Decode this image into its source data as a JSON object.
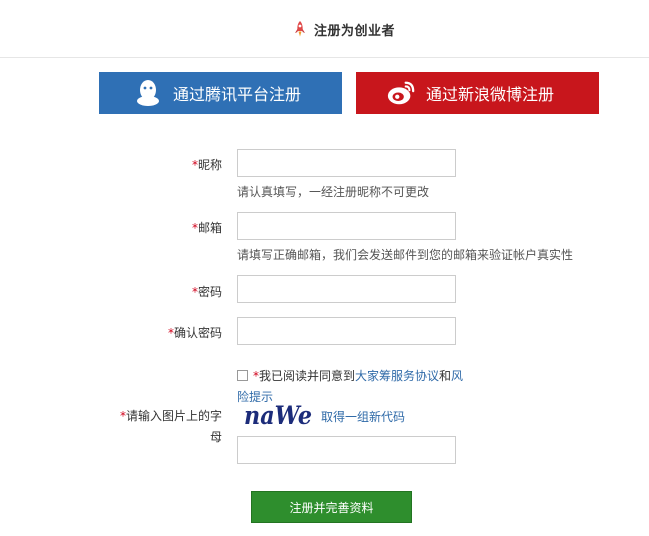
{
  "header": {
    "title": "注册为创业者",
    "icon": "rocket-icon"
  },
  "social": {
    "qq_label": "通过腾讯平台注册",
    "weibo_label": "通过新浪微博注册",
    "qq_color": "#2f70b5",
    "weibo_color": "#c8161c"
  },
  "form": {
    "required_mark": "*",
    "nickname": {
      "label": "昵称",
      "value": "",
      "hint": "请认真填写，一经注册昵称不可更改"
    },
    "email": {
      "label": "邮箱",
      "value": "",
      "hint": "请填写正确邮箱，我们会发送邮件到您的邮箱来验证帐户真实性"
    },
    "password": {
      "label": "密码",
      "value": ""
    },
    "confirm_password": {
      "label": "确认密码",
      "value": ""
    },
    "agreement": {
      "checked": false,
      "prefix": "我已阅读并同意到",
      "link1": "大家筹服务协议",
      "and": "和",
      "link2": "风险提示"
    },
    "captcha": {
      "label": "请输入图片上的字母",
      "image_text": "naWe",
      "refresh_text": "取得一组新代码",
      "value": ""
    },
    "submit_label": "注册并完善资料"
  }
}
